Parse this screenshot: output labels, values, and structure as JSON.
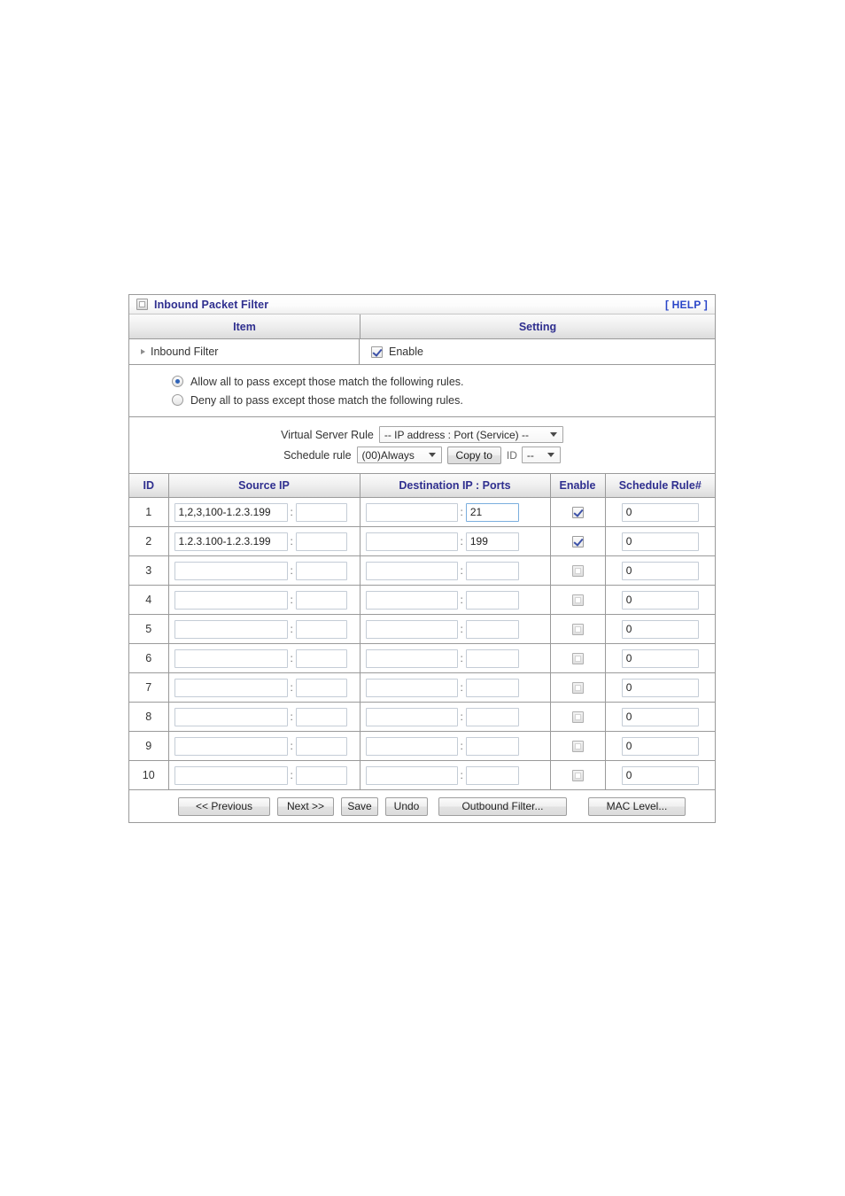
{
  "panel": {
    "title": "Inbound Packet Filter",
    "help_label": "[ HELP ]",
    "title_icon": "window-square-icon"
  },
  "header": {
    "item_label": "Item",
    "setting_label": "Setting"
  },
  "inbound_filter": {
    "label": "Inbound Filter",
    "enable_label": "Enable",
    "enable_checked": true
  },
  "policy": {
    "allow_label": "Allow all to pass except those match the following rules.",
    "deny_label": "Deny all to pass except those match the following rules.",
    "selected": "allow"
  },
  "rule_selector": {
    "virtual_server_rule_label": "Virtual Server Rule",
    "virtual_server_rule_value": "-- IP address : Port (Service) --",
    "schedule_rule_label": "Schedule rule",
    "schedule_rule_value": "(00)Always",
    "copy_to_label": "Copy to",
    "id_label": "ID",
    "id_value": "--"
  },
  "table": {
    "columns": [
      "ID",
      "Source IP",
      "Destination IP : Ports",
      "Enable",
      "Schedule Rule#"
    ],
    "rows": [
      {
        "id": "1",
        "source_ip": "1,2,3,100-1.2.3.199",
        "source_port": "",
        "dest_ip": "",
        "dest_port": "21",
        "enabled": true,
        "schedule_rule": "0",
        "dest_port_focused": true
      },
      {
        "id": "2",
        "source_ip": "1.2.3.100-1.2.3.199",
        "source_port": "",
        "dest_ip": "",
        "dest_port": "199",
        "enabled": true,
        "schedule_rule": "0",
        "dest_port_focused": false
      },
      {
        "id": "3",
        "source_ip": "",
        "source_port": "",
        "dest_ip": "",
        "dest_port": "",
        "enabled": false,
        "schedule_rule": "0",
        "dest_port_focused": false
      },
      {
        "id": "4",
        "source_ip": "",
        "source_port": "",
        "dest_ip": "",
        "dest_port": "",
        "enabled": false,
        "schedule_rule": "0",
        "dest_port_focused": false
      },
      {
        "id": "5",
        "source_ip": "",
        "source_port": "",
        "dest_ip": "",
        "dest_port": "",
        "enabled": false,
        "schedule_rule": "0",
        "dest_port_focused": false
      },
      {
        "id": "6",
        "source_ip": "",
        "source_port": "",
        "dest_ip": "",
        "dest_port": "",
        "enabled": false,
        "schedule_rule": "0",
        "dest_port_focused": false
      },
      {
        "id": "7",
        "source_ip": "",
        "source_port": "",
        "dest_ip": "",
        "dest_port": "",
        "enabled": false,
        "schedule_rule": "0",
        "dest_port_focused": false
      },
      {
        "id": "8",
        "source_ip": "",
        "source_port": "",
        "dest_ip": "",
        "dest_port": "",
        "enabled": false,
        "schedule_rule": "0",
        "dest_port_focused": false
      },
      {
        "id": "9",
        "source_ip": "",
        "source_port": "",
        "dest_ip": "",
        "dest_port": "",
        "enabled": false,
        "schedule_rule": "0",
        "dest_port_focused": false
      },
      {
        "id": "10",
        "source_ip": "",
        "source_port": "",
        "dest_ip": "",
        "dest_port": "",
        "enabled": false,
        "schedule_rule": "0",
        "dest_port_focused": false
      }
    ]
  },
  "footer": {
    "previous_label": "<< Previous",
    "next_label": "Next >>",
    "save_label": "Save",
    "undo_label": "Undo",
    "outbound_filter_label": "Outbound Filter...",
    "mac_level_label": "MAC Level..."
  },
  "colors": {
    "heading_blue": "#2f2f8f",
    "link_blue": "#2a46c8",
    "border_gray": "#9a9a9a",
    "input_border": "#c4ccd6",
    "focus_border": "#7aaede"
  }
}
